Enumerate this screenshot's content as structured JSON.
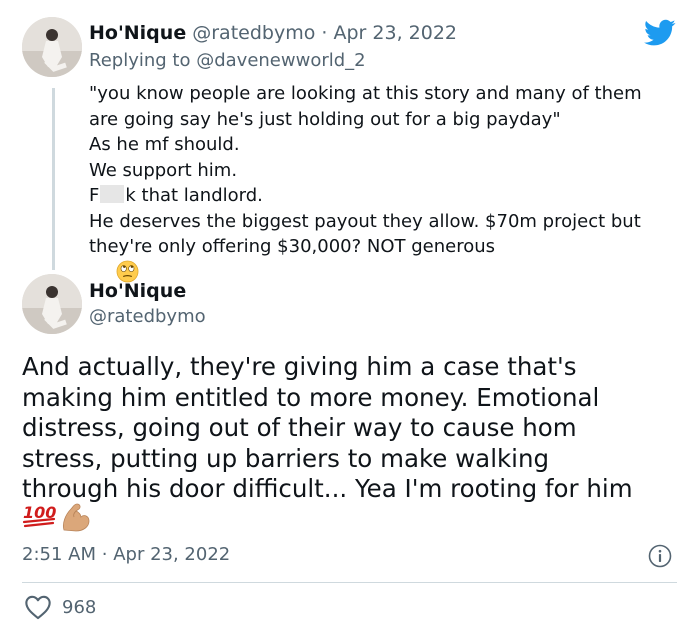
{
  "reply_tweet": {
    "display_name": "Ho'Nique",
    "handle": "@ratedbymo",
    "separator": "·",
    "date": "Apr 23, 2022",
    "replying_to_prefix": "Replying to",
    "replying_to_handle": "@davenewworld_2",
    "lines": [
      "\"you know people are looking at this story and many of them",
      "are going say he's just holding out for a big payday\"",
      "As he mf should.",
      "We support him."
    ],
    "censored_prefix": "F",
    "censored_suffix": "k that landlord.",
    "lines_after": [
      "He deserves the biggest payout they allow. $70m project but"
    ],
    "last_line": "they're only offering $30,000? NOT generous",
    "last_emoji": "face-with-rolling-eyes"
  },
  "main_tweet": {
    "display_name": "Ho'Nique",
    "handle": "@ratedbymo",
    "lines": [
      "And actually, they're giving him a case that's",
      "making him entitled to more money. Emotional",
      "distress, going out of their way to cause hom",
      "stress, putting up barriers to make walking",
      "through his door difficult... Yea I'm rooting for him"
    ],
    "emojis": [
      "hundred-points",
      "flexed-biceps"
    ],
    "emoji_100_text": "100",
    "time": "2:51 AM",
    "separator": "·",
    "date": "Apr 23, 2022",
    "likes": "968"
  },
  "colors": {
    "text": "#0f1419",
    "muted": "#536471",
    "twitter_blue": "#1d9bf0",
    "divider": "#cfd9de",
    "hundred_red": "#d01c1c"
  },
  "icons": [
    "twitter-bird-icon",
    "info-icon",
    "heart-icon"
  ]
}
